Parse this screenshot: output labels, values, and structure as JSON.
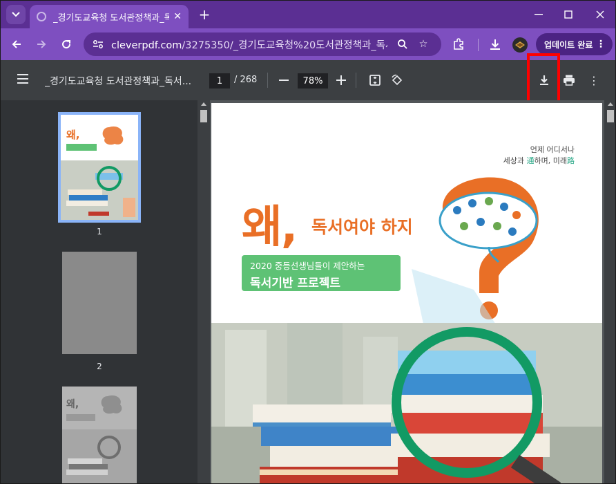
{
  "browser": {
    "tab": {
      "title": "_경기도교육청 도서관정책과_독서..."
    },
    "url": {
      "domain": "cleverpdf.com",
      "path": "/3275350/_경기도교육청%20도서관정책과_독서..."
    },
    "update_label": "업데이트 완료"
  },
  "pdf": {
    "title": "_경기도교육청 도서관정책과_독서...",
    "current_page": "1",
    "total_pages": "/ 268",
    "zoom": "78%"
  },
  "thumbnails": [
    {
      "label": "1"
    },
    {
      "label": "2"
    }
  ],
  "page_content": {
    "slogan_line1": "언제 어디서나",
    "slogan_line2_a": "세상과 ",
    "slogan_line2_b": "通",
    "slogan_line2_c": "하며, 미래",
    "slogan_line2_d": "路",
    "big_title": "왜,",
    "sub_title": "독서여야 하지",
    "green_line1": "2020 중등선생님들이 제안하는",
    "green_line2": "독서기반 프로젝트"
  },
  "colors": {
    "tab_strip": "#5b2f93",
    "toolbar": "#7e4fc0",
    "pdf_toolbar": "#3c3f42",
    "highlight": "#ff0000",
    "brand_orange": "#e96f26",
    "brand_green": "#5ec275",
    "ring_green": "#129a64"
  }
}
